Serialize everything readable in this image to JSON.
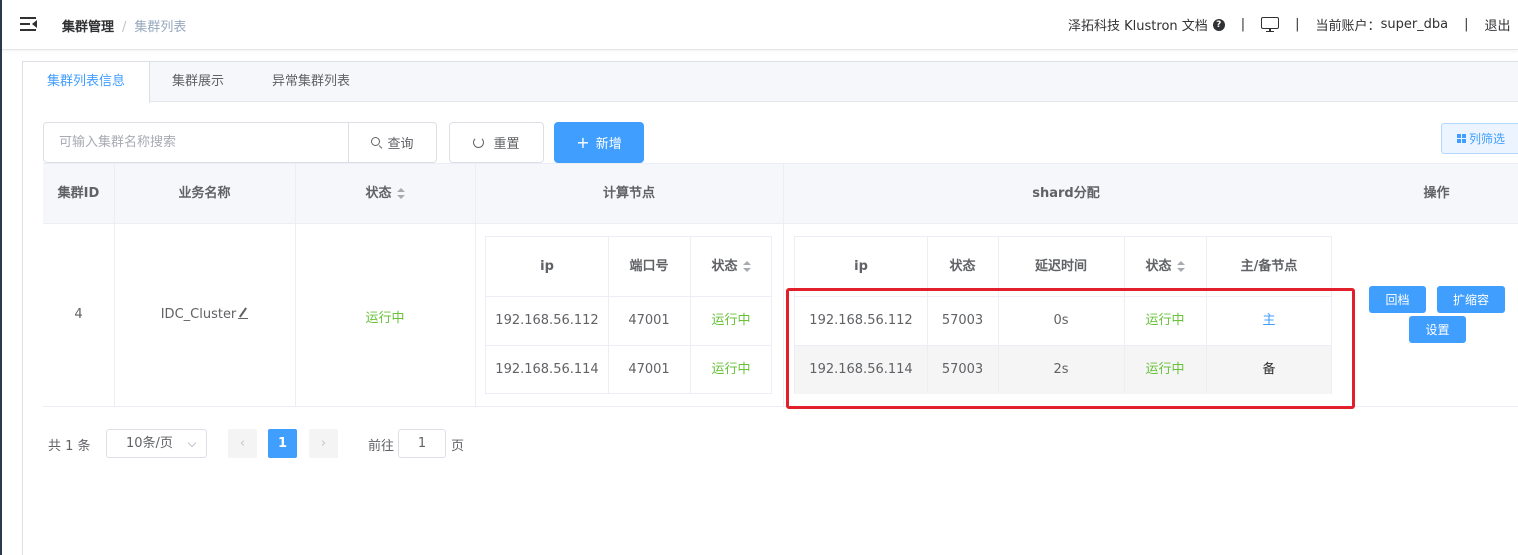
{
  "header": {
    "breadcrumb": [
      "集群管理",
      "集群列表"
    ],
    "doc_link": "泽拓科技 Klustron 文档",
    "account_label": "当前账户：",
    "account_name": "super_dba",
    "logout": "退出"
  },
  "tabs": [
    {
      "label": "集群列表信息",
      "active": true
    },
    {
      "label": "集群展示",
      "active": false
    },
    {
      "label": "异常集群列表",
      "active": false
    }
  ],
  "toolbar": {
    "search_placeholder": "可输入集群名称搜索",
    "query_label": "查询",
    "reset_label": "重置",
    "add_label": "新增",
    "columns_label": "列筛选"
  },
  "table": {
    "headers": {
      "cluster_id": "集群ID",
      "business_name": "业务名称",
      "status": "状态",
      "compute_nodes": "计算节点",
      "shard": "shard分配",
      "operations": "操作"
    },
    "row": {
      "cluster_id": "4",
      "business_name": "IDC_Cluster",
      "status": "运行中",
      "compute_nodes": {
        "headers": [
          "ip",
          "端口号",
          "状态"
        ],
        "rows": [
          [
            "192.168.56.112",
            "47001",
            "运行中"
          ],
          [
            "192.168.56.114",
            "47001",
            "运行中"
          ]
        ]
      },
      "shards": {
        "headers": [
          "ip",
          "状态",
          "延迟时间",
          "状态",
          "主/备节点"
        ],
        "rows": [
          [
            "192.168.56.112",
            "57003",
            "0s",
            "运行中",
            "主"
          ],
          [
            "192.168.56.114",
            "57003",
            "2s",
            "运行中",
            "备"
          ]
        ]
      },
      "operations": [
        "回档",
        "扩缩容",
        "设置"
      ]
    }
  },
  "pagination": {
    "total": "共 1 条",
    "page_size": "10条/页",
    "current_page": "1",
    "goto_label": "前往",
    "goto_value": "1",
    "goto_suffix": "页"
  },
  "colors": {
    "primary": "#409eff",
    "success": "#67c23a",
    "highlight": "#e2202b"
  }
}
